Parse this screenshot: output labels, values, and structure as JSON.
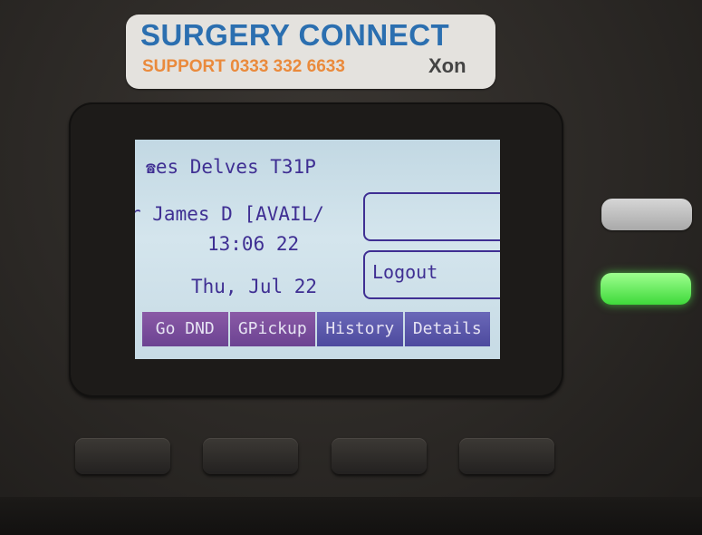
{
  "sticker": {
    "title": "SURGERY CONNECT",
    "support": "SUPPORT 0333 332 6633",
    "logo": "Xon"
  },
  "display": {
    "phone_icon": "phone-icon",
    "line_name": "es Delves T31P",
    "status": "r James D [AVAIL/",
    "time": "13:06 22",
    "date": "Thu, Jul 22",
    "logout_label": "Logout",
    "softkeys": [
      "Go DND",
      "GPickup",
      "History",
      "Details"
    ]
  },
  "colors": {
    "screen_text": "#3f2f93",
    "softkey_bg": "#6c4392",
    "led_green": "#3ed93a",
    "sticker_title": "#2b6fb0",
    "sticker_support": "#ea8a3c"
  }
}
